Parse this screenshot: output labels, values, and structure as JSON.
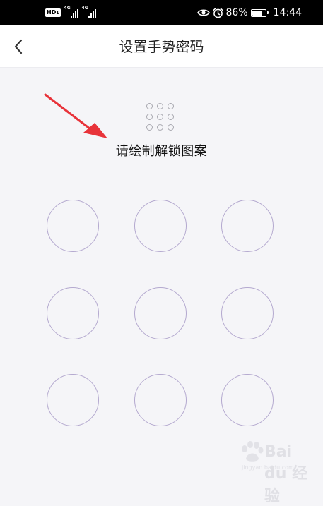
{
  "status_bar": {
    "hd_badge": "HD",
    "hd_sim": "1",
    "net1_label": "4G",
    "net2_label": "4G",
    "battery_percent": "86%",
    "battery_level": 0.86,
    "time": "14:44",
    "icons": [
      "eye-icon",
      "alarm-icon",
      "battery-icon"
    ]
  },
  "nav": {
    "back_icon": "chevron-left-icon",
    "title": "设置手势密码"
  },
  "preview_icon": "pattern-preview-icon",
  "prompt": "请绘制解锁图案",
  "pattern": {
    "rows": 3,
    "cols": 3,
    "ring_color": "#b4a9cf"
  },
  "annotation": {
    "arrow_color": "#e8333a"
  },
  "watermark": {
    "text": "Bai du 经验",
    "sub": "jingyan.baidu.com"
  }
}
